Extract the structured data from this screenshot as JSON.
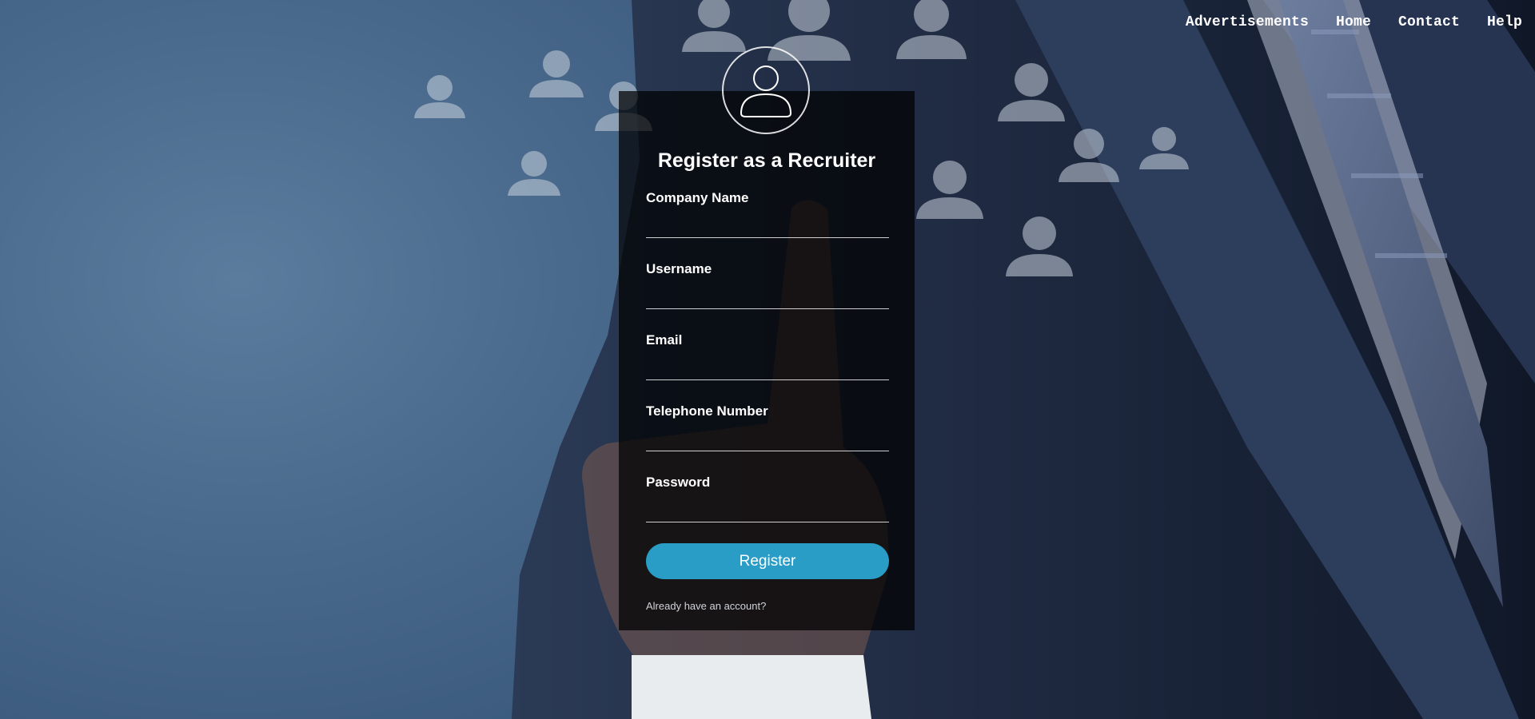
{
  "nav": {
    "items": [
      {
        "label": "Advertisements"
      },
      {
        "label": "Home"
      },
      {
        "label": "Contact"
      },
      {
        "label": "Help"
      }
    ]
  },
  "form": {
    "title": "Register as a Recruiter",
    "avatar_icon": "user-avatar-icon",
    "fields": [
      {
        "label": "Company Name",
        "value": "",
        "placeholder": ""
      },
      {
        "label": "Username",
        "value": "",
        "placeholder": ""
      },
      {
        "label": "Email",
        "value": "",
        "placeholder": ""
      },
      {
        "label": "Telephone Number",
        "value": "",
        "placeholder": ""
      },
      {
        "label": "Password",
        "value": "",
        "placeholder": ""
      }
    ],
    "submit_label": "Register",
    "login_link": "Already have an account?"
  },
  "colors": {
    "button": "#2a9dc6",
    "card_background": "rgba(0,0,0,0.72)",
    "background": "#4a6a8d"
  },
  "background": {
    "icons": [
      "people-icon",
      "businessman-figure"
    ]
  }
}
